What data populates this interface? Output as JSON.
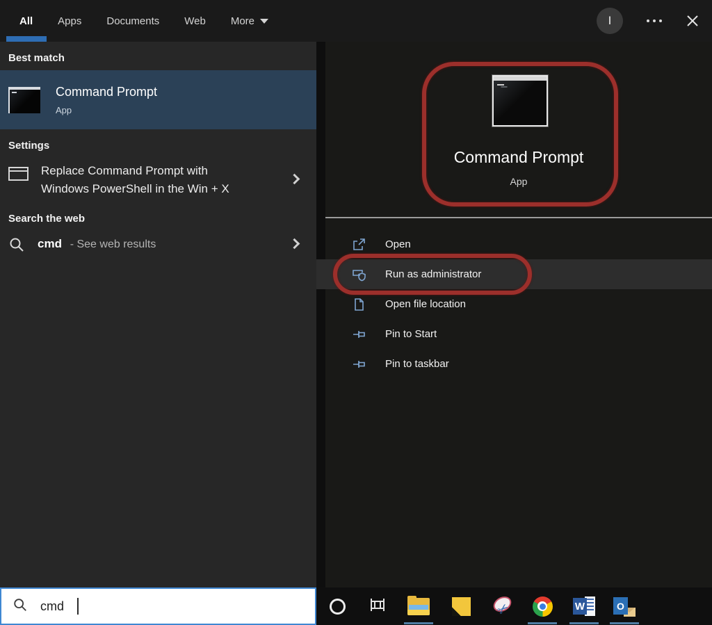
{
  "colors": {
    "accent_blue": "#2e6db4",
    "best_match_highlight": "#2b4157",
    "annotation_red": "#9c2f2b",
    "taskbar_indicator": "#4f7da3"
  },
  "topbar": {
    "tabs": [
      {
        "label": "All",
        "active": true
      },
      {
        "label": "Apps",
        "active": false
      },
      {
        "label": "Documents",
        "active": false
      },
      {
        "label": "Web",
        "active": false
      },
      {
        "label": "More",
        "active": false,
        "has_dropdown": true
      }
    ],
    "avatar_initial": "I"
  },
  "left_panel": {
    "best_match": {
      "header": "Best match",
      "item": {
        "title": "Command Prompt",
        "subtitle": "App"
      }
    },
    "settings": {
      "header": "Settings",
      "item": {
        "line1": "Replace Command Prompt with",
        "line2": "Windows PowerShell in the Win + X"
      }
    },
    "search_web": {
      "header": "Search the web",
      "item": {
        "query": "cmd",
        "suffix": "- See web results"
      }
    }
  },
  "right_panel": {
    "app_title": "Command Prompt",
    "app_subtitle": "App",
    "actions": [
      {
        "label": "Open",
        "highlighted": false
      },
      {
        "label": "Run as administrator",
        "highlighted": true
      },
      {
        "label": "Open file location",
        "highlighted": false
      },
      {
        "label": "Pin to Start",
        "highlighted": false
      },
      {
        "label": "Pin to taskbar",
        "highlighted": false
      }
    ]
  },
  "search_box": {
    "value": "cmd"
  },
  "taskbar": {
    "icons": [
      {
        "name": "cortana",
        "open": false
      },
      {
        "name": "task-view",
        "open": false
      },
      {
        "name": "file-explorer",
        "open": true
      },
      {
        "name": "sticky-notes",
        "open": false
      },
      {
        "name": "snipping-tool",
        "open": false
      },
      {
        "name": "chrome",
        "open": true
      },
      {
        "name": "word",
        "open": true
      },
      {
        "name": "outlook",
        "open": true
      }
    ]
  }
}
